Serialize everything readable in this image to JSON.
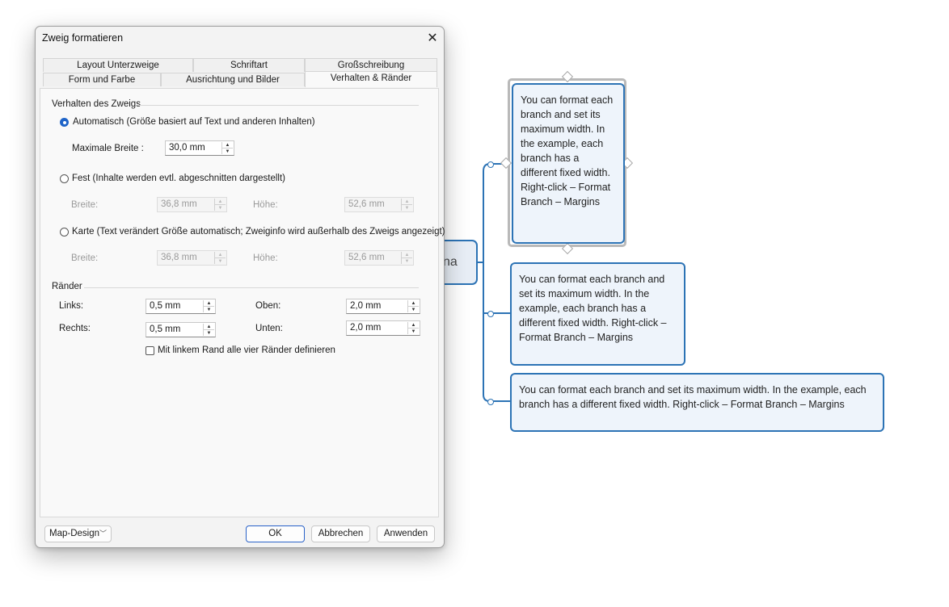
{
  "mindmap": {
    "central_fragment": "na",
    "branches": [
      {
        "text": "You can format each branch and set its maximum width. In the example, each branch has a different fixed width. Right-click – Format Branch – Margins"
      },
      {
        "text": "You can format each branch and set its maximum width. In the example, each branch has a different fixed width. Right-click – Format Branch – Margins"
      },
      {
        "text": "You can format each branch and set its maximum width. In the example, each branch has a different fixed width. Right-click – Format Branch – Margins"
      }
    ],
    "colors": {
      "accent": "#2c73b5",
      "branch_fill": "#eef4fb",
      "selection": "#b9b9b9"
    }
  },
  "dialog": {
    "title": "Zweig formatieren",
    "close_icon": "close-icon",
    "tabs_row1": [
      "Layout Unterzweige",
      "Schriftart",
      "Großschreibung"
    ],
    "tabs_row2": [
      "Form und Farbe",
      "Ausrichtung und Bilder",
      "Verhalten & Ränder"
    ],
    "active_tab": "Verhalten & Ränder",
    "behavior": {
      "group_label": "Verhalten des Zweigs",
      "auto_label": "Automatisch (Größe basiert auf Text und anderen Inhalten)",
      "max_width_label": "Maximale Breite :",
      "max_width_value": "30,0 mm",
      "fixed_label": "Fest (Inhalte werden evtl. abgeschnitten dargestellt)",
      "fixed_width_label": "Breite:",
      "fixed_width_value": "36,8 mm",
      "fixed_height_label": "Höhe:",
      "fixed_height_value": "52,6 mm",
      "card_label": "Karte (Text verändert Größe automatisch; Zweiginfo wird außerhalb des Zweigs angezeigt)",
      "card_width_label": "Breite:",
      "card_width_value": "36,8 mm",
      "card_height_label": "Höhe:",
      "card_height_value": "52,6 mm",
      "selected": "auto"
    },
    "margins": {
      "group_label": "Ränder",
      "left_label": "Links:",
      "left_value": "0,5 mm",
      "right_label": "Rechts:",
      "right_value": "0,5 mm",
      "top_label": "Oben:",
      "top_value": "2,0 mm",
      "bottom_label": "Unten:",
      "bottom_value": "2,0 mm",
      "all_checkbox_label": "Mit linkem Rand alle vier Ränder definieren",
      "all_checked": false
    },
    "footer": {
      "map_design_label": "Map-Design",
      "ok_label": "OK",
      "cancel_label": "Abbrechen",
      "apply_label": "Anwenden"
    },
    "colors": {
      "primary_border": "#2a62c8",
      "radio_checked": "#1f64c8"
    }
  }
}
